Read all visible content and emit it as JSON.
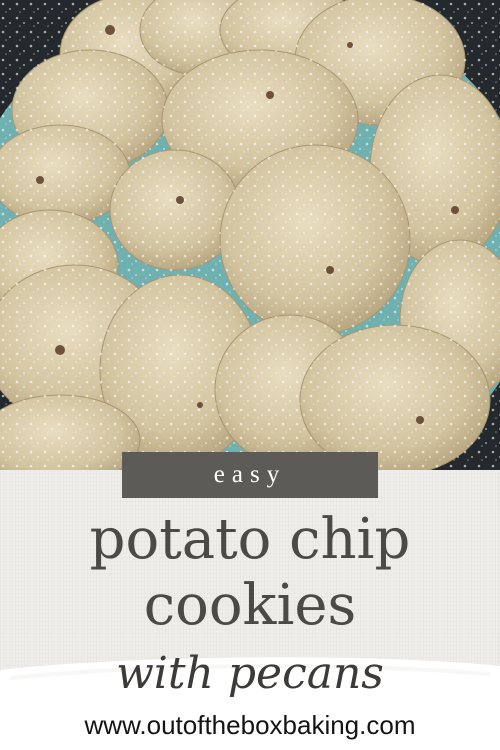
{
  "tag": "easy",
  "title_line1": "potato chip",
  "title_line2": "cookies",
  "subtitle": "with pecans",
  "website": "www.outoftheboxbaking.com",
  "colors": {
    "plate": "#6fb1b0",
    "counter": "#1f2528",
    "cookie": "#d6c8a6",
    "tag_bg": "#5d5b57",
    "title_text": "#4c4a47"
  }
}
